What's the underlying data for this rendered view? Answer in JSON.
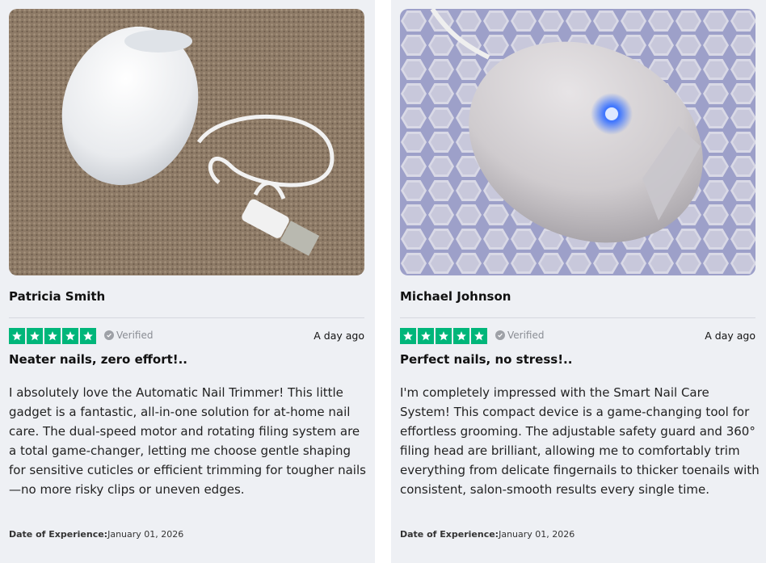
{
  "reviews": [
    {
      "name": "Patricia Smith",
      "rating": 5,
      "verified_label": "Verified",
      "date_ago": "A day ago",
      "headline": "Neater nails, zero effort!..",
      "body": "I absolutely love the Automatic Nail Trimmer! This little gadget is a fantastic, all-in-one solution for at-home nail care. The dual-speed motor and rotating filing system are a total game-changer, letting me choose gentle shaping for sensitive cuticles or efficient trimming for tougher nails—no more risky clips or uneven edges.",
      "date_label": "Date of Experience:",
      "date_value": "January 01, 2026"
    },
    {
      "name": "Michael Johnson",
      "rating": 5,
      "verified_label": "Verified",
      "date_ago": "A day ago",
      "headline": "Perfect nails, no stress!..",
      "body": "I'm completely impressed with the Smart Nail Care System! This compact device is a game-changing tool for effortless grooming. The adjustable safety guard and 360° filing head are brilliant, allowing me to comfortably trim everything from delicate fingernails to thicker toenails with consistent, salon-smooth results every single time.",
      "date_label": "Date of Experience:",
      "date_value": "January 01, 2026"
    }
  ],
  "colors": {
    "star_green": "#00b67a",
    "card_bg": "#eef0f4"
  },
  "icons": [
    "star-icon",
    "verified-check-icon"
  ]
}
